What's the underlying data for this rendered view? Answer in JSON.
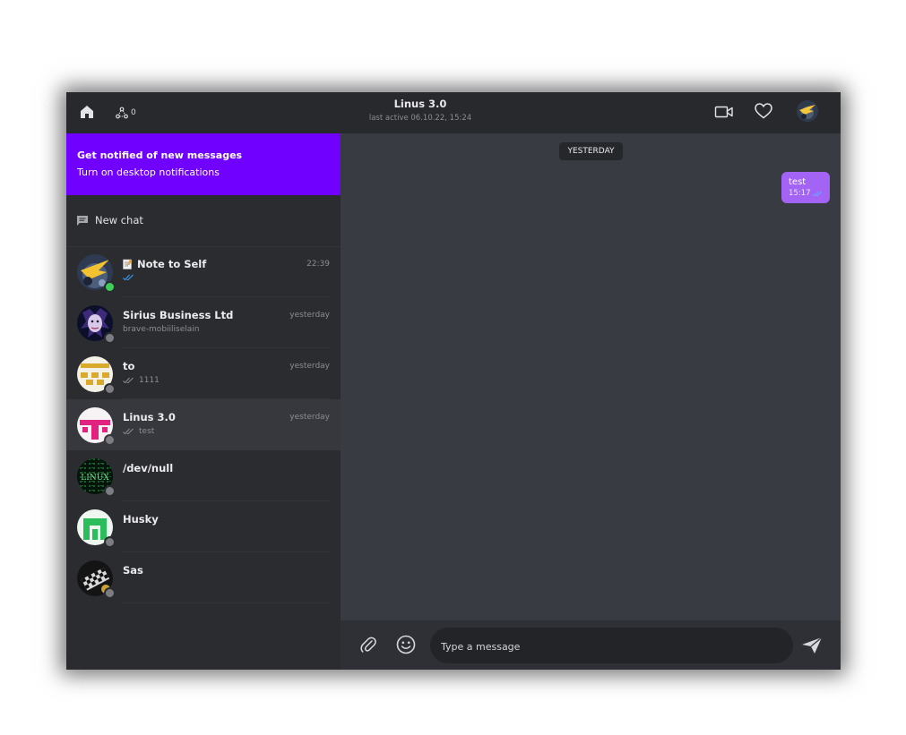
{
  "header": {
    "peer_count": "0",
    "chat_title": "Linus 3.0",
    "chat_subtitle": "last active 06.10.22, 15:24"
  },
  "notification_banner": {
    "title": "Get notified of new messages",
    "subtitle": "Turn on desktop notifications",
    "color": "#7000ff"
  },
  "new_chat_label": "New chat",
  "chats": [
    {
      "name": "Note to Self",
      "time": "22:39",
      "preview": "",
      "status": "online",
      "icon": "note-icon",
      "read_ticks": true,
      "tick_color": "#3aa3ff"
    },
    {
      "name": "Sirius Business Ltd",
      "time": "yesterday",
      "preview": "brave-mobiiliselаin",
      "status": "offline"
    },
    {
      "name": "to",
      "time": "yesterday",
      "preview": "1111",
      "status": "offline",
      "read_ticks": true
    },
    {
      "name": "Linus 3.0",
      "time": "yesterday",
      "preview": "test",
      "status": "offline",
      "read_ticks": true,
      "active": true
    },
    {
      "name": "/dev/null",
      "time": "",
      "preview": "",
      "status": "offline"
    },
    {
      "name": "Husky",
      "time": "",
      "preview": "",
      "status": "offline"
    },
    {
      "name": "Sas",
      "time": "",
      "preview": "",
      "status": "offline"
    }
  ],
  "conversation": {
    "day_label": "YESTERDAY",
    "messages": [
      {
        "text": "test",
        "time": "15:17",
        "outgoing": true,
        "color": "#a363f5"
      }
    ]
  },
  "composer": {
    "placeholder": "Type a message",
    "value": ""
  },
  "colors": {
    "accent": "#7000ff",
    "bubble": "#a363f5",
    "online": "#3ecf5a"
  }
}
